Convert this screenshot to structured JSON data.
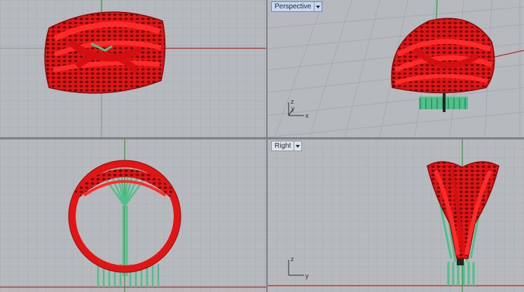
{
  "viewports": {
    "top": {
      "label": ""
    },
    "perspective": {
      "label": "Perspective",
      "active": true
    },
    "front": {
      "label": ""
    },
    "right": {
      "label": "Right"
    }
  },
  "axes": {
    "perspective": {
      "x": "x",
      "y": "y",
      "z": "z"
    },
    "right": {
      "y": "y",
      "z": "z"
    }
  },
  "colors": {
    "viewport_bg": "#b6b9bd",
    "grid_minor": "#a9acb0",
    "grid_major": "#8f9398",
    "axis_x": "#b02a2a",
    "axis_y": "#2aa02a",
    "model_red": "#e11515",
    "model_red_dark": "#8a0a0a",
    "support_green": "#4fc08a"
  }
}
